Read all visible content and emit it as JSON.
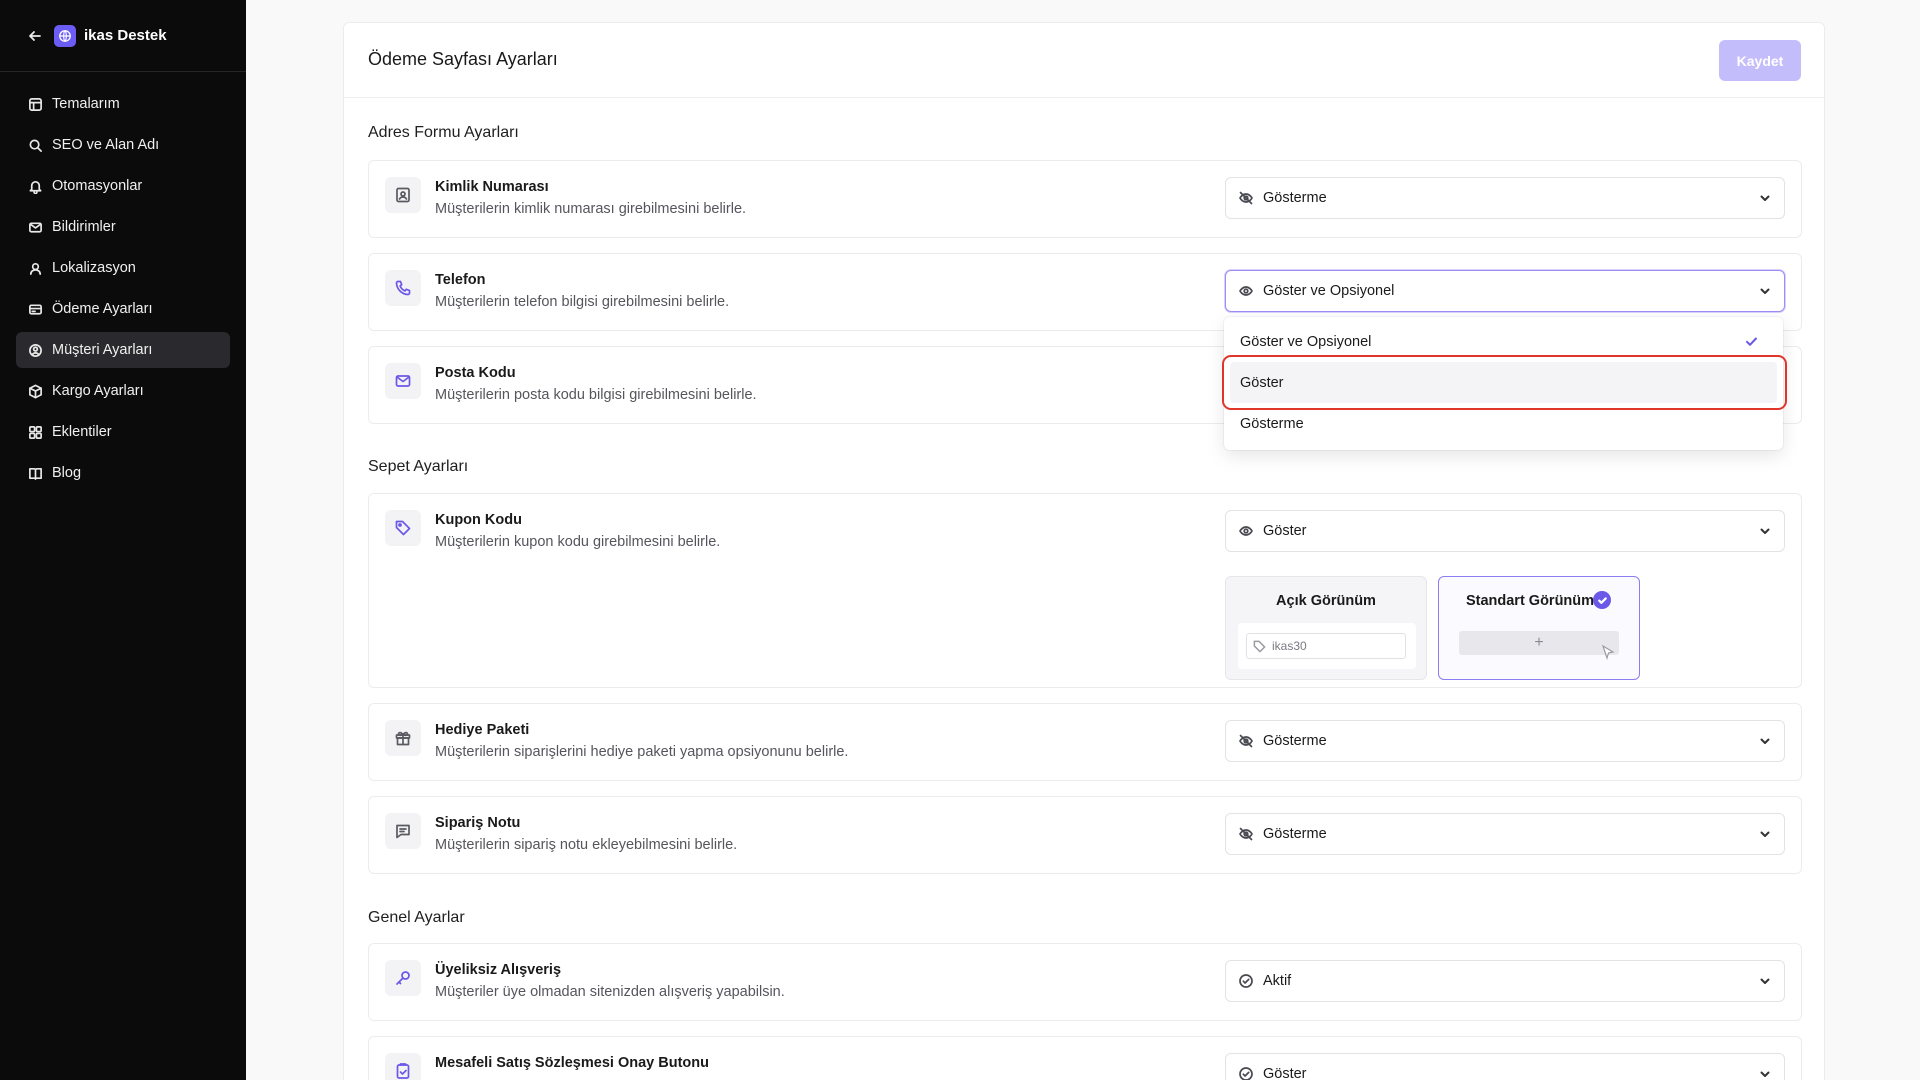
{
  "sidebar": {
    "title": "ikas Destek",
    "items": [
      {
        "label": "Temalarım",
        "icon": "layout-icon"
      },
      {
        "label": "SEO ve Alan Adı",
        "icon": "search-icon"
      },
      {
        "label": "Otomasyonlar",
        "icon": "bell-icon"
      },
      {
        "label": "Bildirimler",
        "icon": "mail-icon"
      },
      {
        "label": "Lokalizasyon",
        "icon": "user-location-icon"
      },
      {
        "label": "Ödeme Ayarları",
        "icon": "credit-card-icon"
      },
      {
        "label": "Müşteri Ayarları",
        "icon": "user-circle-icon",
        "active": true
      },
      {
        "label": "Kargo Ayarları",
        "icon": "package-icon"
      },
      {
        "label": "Eklentiler",
        "icon": "grid-icon"
      },
      {
        "label": "Blog",
        "icon": "book-icon"
      }
    ]
  },
  "page": {
    "title": "Ödeme Sayfası Ayarları",
    "save_label": "Kaydet"
  },
  "sections": {
    "address": "Adres Formu Ayarları",
    "cart": "Sepet Ayarları",
    "general": "Genel Ayarlar"
  },
  "rows": {
    "kimlik": {
      "title": "Kimlik Numarası",
      "desc": "Müşterilerin kimlik numarası girebilmesini belirle.",
      "value": "Gösterme"
    },
    "telefon": {
      "title": "Telefon",
      "desc": "Müşterilerin telefon bilgisi girebilmesini belirle.",
      "value": "Göster ve Opsiyonel"
    },
    "posta": {
      "title": "Posta Kodu",
      "desc": "Müşterilerin posta kodu bilgisi girebilmesini belirle."
    },
    "kupon": {
      "title": "Kupon Kodu",
      "desc": "Müşterilerin kupon kodu girebilmesini belirle.",
      "value": "Göster"
    },
    "hediye": {
      "title": "Hediye Paketi",
      "desc": "Müşterilerin siparişlerini hediye paketi yapma opsiyonunu belirle.",
      "value": "Gösterme"
    },
    "not": {
      "title": "Sipariş Notu",
      "desc": "Müşterilerin sipariş notu ekleyebilmesini belirle.",
      "value": "Gösterme"
    },
    "uyeliksiz": {
      "title": "Üyeliksiz Alışveriş",
      "desc": "Müşteriler üye olmadan sitenizden alışveriş yapabilsin.",
      "value": "Aktif"
    },
    "mesafeli": {
      "title": "Mesafeli Satış Sözleşmesi Onay Butonu",
      "value": "Göster"
    }
  },
  "dropdown": {
    "options": [
      "Göster ve Opsiyonel",
      "Göster",
      "Gösterme"
    ],
    "selected": "Göster ve Opsiyonel",
    "hovered": "Göster"
  },
  "coupon_styles": {
    "open_label": "Açık Görünüm",
    "standard_label": "Standart Görünüm",
    "sample_code": "ikas30",
    "plus": "+",
    "selected": "Standart Görünüm"
  },
  "colors": {
    "accent": "#6b57e8",
    "save_disabled": "#c4bdfb",
    "highlight": "#e0352b",
    "sidebar_bg": "#0b0b0c"
  }
}
